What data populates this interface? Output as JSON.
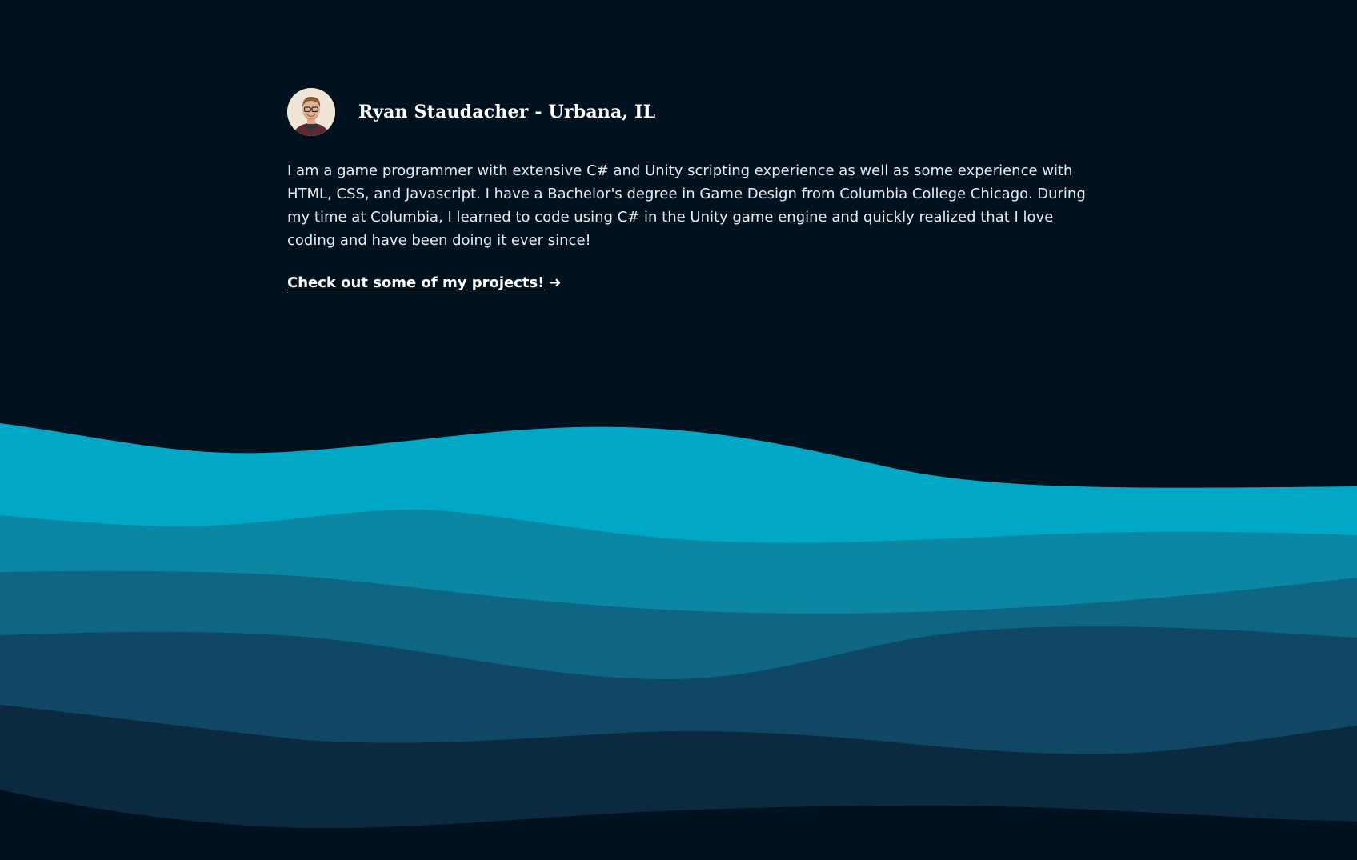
{
  "header": {
    "title": "Ryan Staudacher - Urbana, IL",
    "avatar_alt": "Profile photo"
  },
  "bio": {
    "text": "I am a game programmer with extensive C# and Unity scripting experience as well as some experience with HTML, CSS, and Javascript. I have a Bachelor's degree in Game Design from Columbia College Chicago. During my time at Columbia, I learned to code using C# in the Unity game engine and quickly realized that I love coding and have been doing it ever since!"
  },
  "cta": {
    "label": "Check out some of my projects!",
    "arrow": "➜"
  },
  "colors": {
    "background": "#001220",
    "wave_1": "#00a8c6",
    "wave_2": "#0b87a4",
    "wave_3": "#0f6683",
    "wave_4": "#104764",
    "wave_5": "#0b2a40",
    "text": "#e6ebef"
  }
}
